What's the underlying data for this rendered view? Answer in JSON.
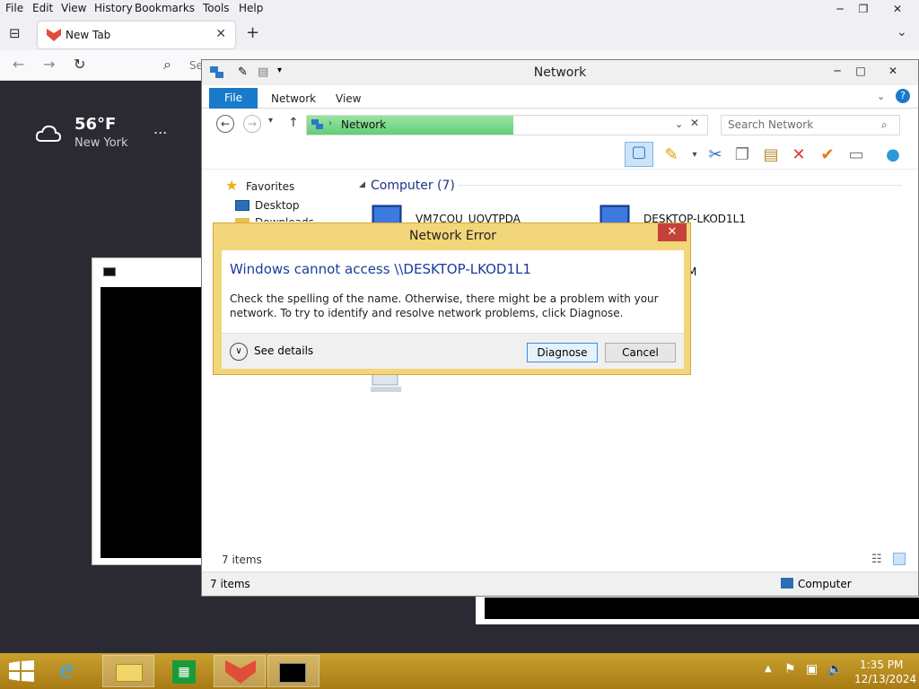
{
  "browser": {
    "menu": [
      "File",
      "Edit",
      "View",
      "History",
      "Bookmarks",
      "Tools",
      "Help"
    ],
    "tab_title": "New Tab",
    "search_placeholder": "Se",
    "weather": {
      "temperature": "56°F",
      "city": "New York",
      "more": "..."
    }
  },
  "explorer": {
    "title": "Network",
    "ribbon_tabs": [
      "File",
      "Network",
      "View"
    ],
    "address": "Network",
    "search_placeholder": "Search Network",
    "favorites_label": "Favorites",
    "nav_items": [
      "Desktop",
      "Downloads"
    ],
    "group_header": "Computer (7)",
    "computers": [
      "VM7COU_UOVTPDA",
      "DESKTOP-LKOD1L1"
    ],
    "partial_label": "M",
    "status_items": "7 items",
    "statusbar_items": "7 items",
    "statusbar_zone": "Computer"
  },
  "dialog": {
    "title": "Network Error",
    "heading": "Windows cannot access \\\\DESKTOP-LKOD1L1",
    "message": "Check the spelling of the name. Otherwise, there might be a problem with your network. To try to identify and resolve network problems, click Diagnose.",
    "details": "See details",
    "diagnose": "Diagnose",
    "cancel": "Cancel",
    "close_glyph": "✕"
  },
  "taskbar": {
    "time": "1:35 PM",
    "date": "12/13/2024",
    "apps": [
      "start",
      "internet-explorer",
      "file-explorer",
      "store",
      "firefox",
      "command-prompt"
    ]
  }
}
